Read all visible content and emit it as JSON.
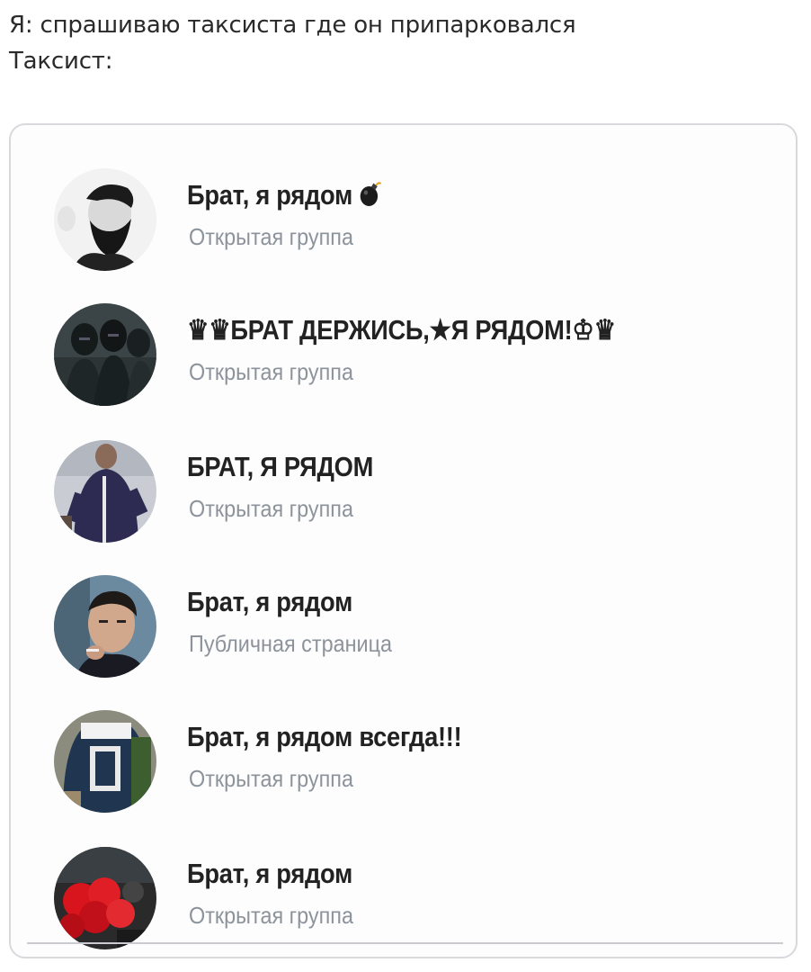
{
  "caption": {
    "line1": "Я: спрашиваю таксиста где он припарковался",
    "line2": "Таксист:"
  },
  "groups": [
    {
      "name": "Брат, я рядом",
      "type": "Открытая группа",
      "avatar": "bearded-man-avatar",
      "icon": "bomb-icon"
    },
    {
      "name": "♛♛БРАТ ДЕРЖИСЬ,★Я РЯДОМ!♔♛",
      "type": "Открытая группа",
      "avatar": "masked-men-avatar"
    },
    {
      "name": "БРАТ, Я РЯДОМ",
      "type": "Открытая группа",
      "avatar": "man-in-tracksuit-avatar"
    },
    {
      "name": "Брат, я рядом",
      "type": "Публичная страница",
      "avatar": "young-man-smoking-avatar"
    },
    {
      "name": "Брат, я рядом всегда!!!",
      "type": "Открытая группа",
      "avatar": "sports-jersey-avatar"
    },
    {
      "name": "Брат, я рядом",
      "type": "Открытая группа",
      "avatar": "red-flowers-avatar"
    }
  ],
  "colors": {
    "name_text": "#222222",
    "subtitle_text": "#8c939b",
    "card_border": "#d7d9dc"
  }
}
